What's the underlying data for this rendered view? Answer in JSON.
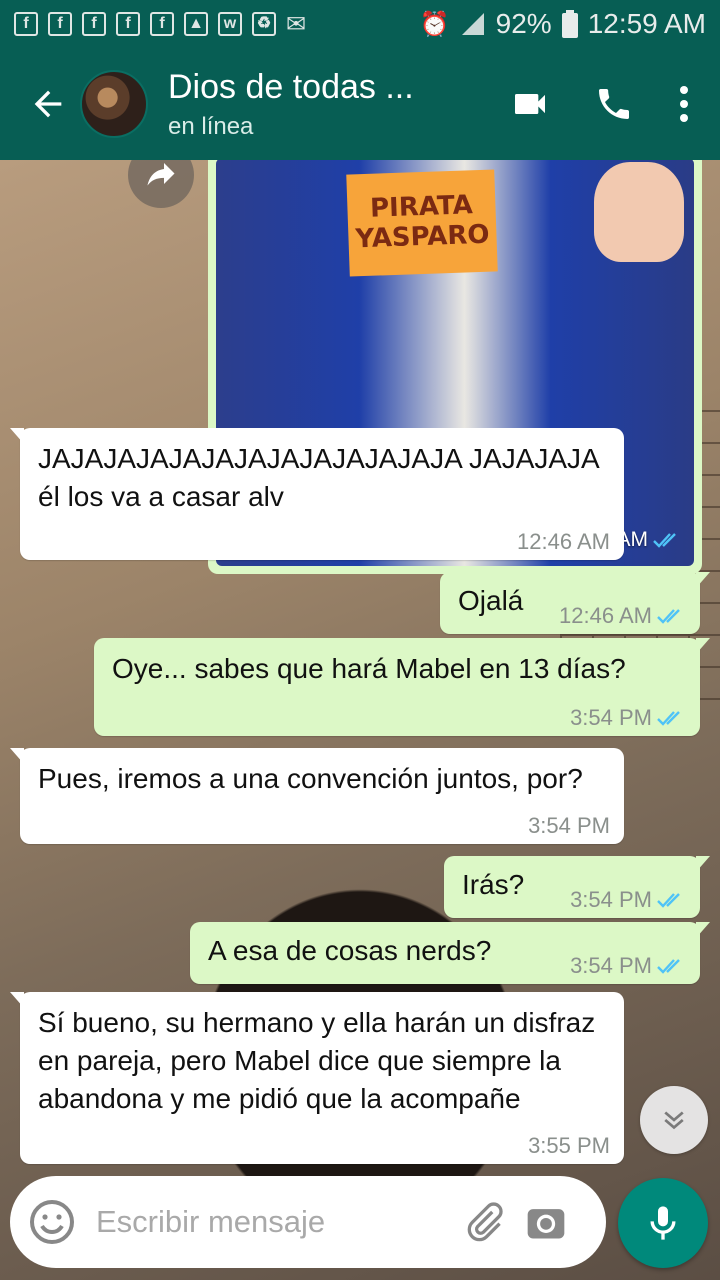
{
  "status_bar": {
    "notification_icons": [
      "facebook-icon",
      "facebook-icon",
      "facebook-icon",
      "facebook-icon",
      "facebook-icon",
      "gallery-icon",
      "wattpad-icon",
      "recycle-icon",
      "mail-icon"
    ],
    "battery": "92%",
    "time": "12:59 AM"
  },
  "header": {
    "contact_name": "Dios de todas ...",
    "contact_status": "en línea"
  },
  "image_message": {
    "sign_line1": "PIRATA",
    "sign_line2": "YASPARO",
    "time": "12:46 AM",
    "status": "read"
  },
  "messages": [
    {
      "direction": "in",
      "text": "JAJAJAJAJAJAJAJAJAJAJAJAJA JAJAJAJA él los va a casar alv",
      "time": "12:46 AM"
    },
    {
      "direction": "out",
      "text": "Ojalá",
      "time": "12:46 AM",
      "status": "read"
    },
    {
      "direction": "out",
      "text": "Oye... sabes que hará Mabel en 13 días?",
      "time": "3:54 PM",
      "status": "read"
    },
    {
      "direction": "in",
      "text": "Pues, iremos a una convención juntos, por?",
      "time": "3:54 PM"
    },
    {
      "direction": "out",
      "text": "Irás?",
      "time": "3:54 PM",
      "status": "read"
    },
    {
      "direction": "out",
      "text": "A esa de cosas nerds?",
      "time": "3:54 PM",
      "status": "read"
    },
    {
      "direction": "in",
      "text": "Sí bueno, su hermano y ella harán un disfraz en pareja, pero Mabel dice que siempre la abandona y me pidió que la acompañe",
      "time": "3:55 PM"
    }
  ],
  "input": {
    "placeholder": "Escribir mensaje"
  },
  "colors": {
    "header": "#075e54",
    "outgoing_bubble": "#dcf8c6",
    "incoming_bubble": "#ffffff",
    "read_ticks": "#4fc3f7",
    "mic_button": "#00897b"
  }
}
